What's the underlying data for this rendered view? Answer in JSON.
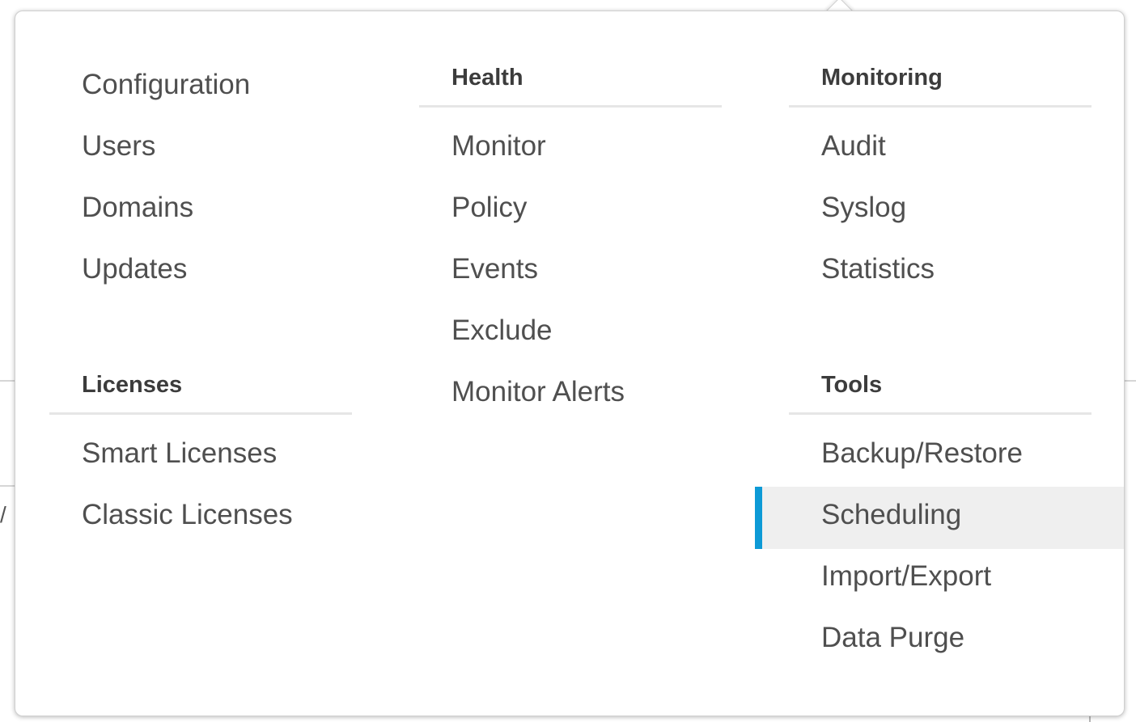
{
  "menu": {
    "admin": {
      "items": [
        {
          "label": "Configuration"
        },
        {
          "label": "Users"
        },
        {
          "label": "Domains"
        },
        {
          "label": "Updates"
        }
      ]
    },
    "licenses": {
      "heading": "Licenses",
      "items": [
        {
          "label": "Smart Licenses"
        },
        {
          "label": "Classic Licenses"
        }
      ]
    },
    "health": {
      "heading": "Health",
      "items": [
        {
          "label": "Monitor"
        },
        {
          "label": "Policy"
        },
        {
          "label": "Events"
        },
        {
          "label": "Exclude"
        },
        {
          "label": "Monitor Alerts"
        }
      ]
    },
    "monitoring": {
      "heading": "Monitoring",
      "items": [
        {
          "label": "Audit"
        },
        {
          "label": "Syslog"
        },
        {
          "label": "Statistics"
        }
      ]
    },
    "tools": {
      "heading": "Tools",
      "items": [
        {
          "label": "Backup/Restore"
        },
        {
          "label": "Scheduling",
          "active": true
        },
        {
          "label": "Import/Export"
        },
        {
          "label": "Data Purge"
        }
      ]
    },
    "active_indicator_color": "#0d9ad6"
  }
}
